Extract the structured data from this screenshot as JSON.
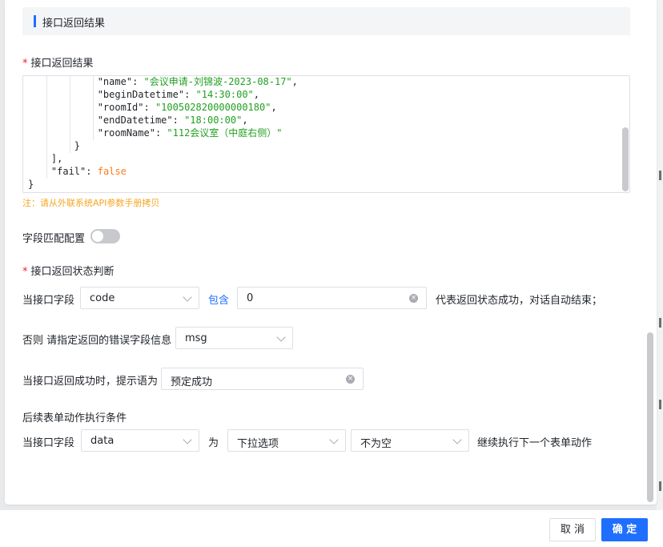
{
  "section": {
    "title": "接口返回结果"
  },
  "response_field": {
    "label": "接口返回结果",
    "code_lines": [
      {
        "indent": "            ",
        "key": "\"name\"",
        "sep": ": ",
        "value": "\"会议申请-刘锦波-2023-08-17\"",
        "tail": ","
      },
      {
        "indent": "            ",
        "key": "\"beginDatetime\"",
        "sep": ": ",
        "value": "\"14:30:00\"",
        "tail": ","
      },
      {
        "indent": "            ",
        "key": "\"roomId\"",
        "sep": ": ",
        "value": "\"100502820000000180\"",
        "tail": ","
      },
      {
        "indent": "            ",
        "key": "\"endDatetime\"",
        "sep": ": ",
        "value": "\"18:00:00\"",
        "tail": ","
      },
      {
        "indent": "            ",
        "key": "\"roomName\"",
        "sep": ": ",
        "value": "\"112会议室（中庭右侧）\"",
        "tail": ""
      },
      {
        "indent": "        ",
        "key": "}",
        "sep": "",
        "value": "",
        "tail": ""
      },
      {
        "indent": "    ",
        "key": "],",
        "sep": "",
        "value": "",
        "tail": ""
      },
      {
        "indent": "    ",
        "key": "\"fail\"",
        "sep": ": ",
        "value": "false",
        "tail": ""
      },
      {
        "indent": "",
        "key": "}",
        "sep": "",
        "value": "",
        "tail": ""
      }
    ],
    "note": "注：请从外联系统API参数手册拷贝"
  },
  "field_match": {
    "label": "字段匹配配置",
    "enabled": false
  },
  "status_judgment": {
    "label": "接口返回状态判断",
    "prefix": "当接口字段",
    "field_value": "code",
    "operator": "包含",
    "match_value": "0",
    "suffix": "代表返回状态成功，对话自动结束；"
  },
  "error_field": {
    "label": "否则 请指定返回的错误字段信息",
    "value": "msg"
  },
  "success_prompt": {
    "label": "当接口返回成功时，提示语为",
    "value": "预定成功"
  },
  "followup": {
    "title": "后续表单动作执行条件",
    "prefix": "当接口字段",
    "field_value": "data",
    "mid": "为",
    "option_value": "下拉选项",
    "condition_value": "不为空",
    "suffix": "继续执行下一个表单动作"
  },
  "footer": {
    "cancel_label": "取 消",
    "ok_label": "确 定"
  },
  "colors": {
    "primary": "#1f6fff",
    "required": "#f5222d",
    "note": "#f5a623",
    "string": "#22a022",
    "boolean": "#ff7a1a"
  }
}
